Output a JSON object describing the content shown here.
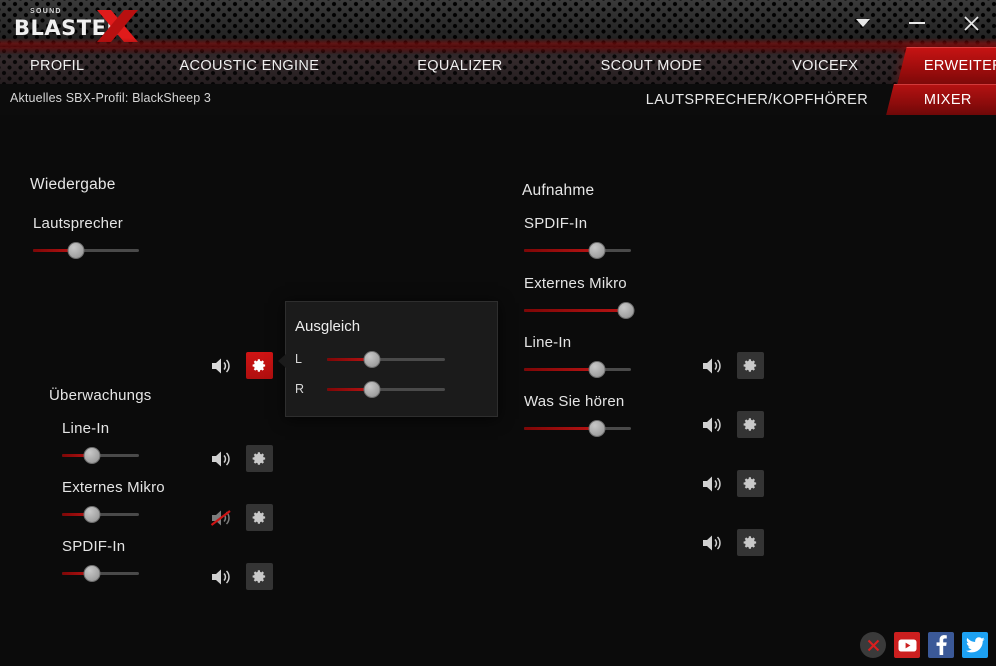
{
  "titlebar": {
    "logo_top": "SOUND",
    "logo_main": "BLASTER",
    "logo_x": "X",
    "dropdown_icon": "chevron-down-icon",
    "minimize_icon": "minimize-icon",
    "close_icon": "close-icon"
  },
  "tabs": [
    {
      "label": "PROFIL",
      "active": false
    },
    {
      "label": "ACOUSTIC ENGINE",
      "active": false
    },
    {
      "label": "EQUALIZER",
      "active": false
    },
    {
      "label": "SCOUT MODE",
      "active": false
    },
    {
      "label": "VOICEFX",
      "active": false
    },
    {
      "label": "ERWEITERTE EINSTELLUNGEN",
      "active": true
    }
  ],
  "subheader": {
    "profile_text": "Aktuelles SBX-Profil: BlackSheep 3",
    "subtabs": [
      {
        "label": "LAUTSPRECHER/KOPFHÖRER",
        "active": false
      },
      {
        "label": "MIXER",
        "active": true
      }
    ]
  },
  "playback": {
    "title": "Wiedergabe",
    "channels": [
      {
        "label": "Lautsprecher",
        "value": 41,
        "muted": false,
        "gear_active": true,
        "indent": false
      },
      {
        "label": "Überwachungs",
        "value": null,
        "is_group_label": true
      },
      {
        "label": "Line-In",
        "value": 39,
        "muted": false,
        "gear_active": false,
        "indent": true
      },
      {
        "label": "Externes Mikro",
        "value": 39,
        "muted": true,
        "gear_active": false,
        "indent": true
      },
      {
        "label": "SPDIF-In",
        "value": 39,
        "muted": false,
        "gear_active": false,
        "indent": true
      }
    ]
  },
  "recording": {
    "title": "Aufnahme",
    "channels": [
      {
        "label": "SPDIF-In",
        "value": 68,
        "muted": false,
        "gear_active": false
      },
      {
        "label": "Externes Mikro",
        "value": 95,
        "muted": false,
        "gear_active": false
      },
      {
        "label": "Line-In",
        "value": 68,
        "muted": false,
        "gear_active": false
      },
      {
        "label": "Was Sie hören",
        "value": 68,
        "muted": false,
        "gear_active": false
      }
    ]
  },
  "balance_popup": {
    "title": "Ausgleich",
    "left": {
      "label": "L",
      "value": 38
    },
    "right": {
      "label": "R",
      "value": 38
    }
  },
  "social": [
    {
      "name": "close-overlay-icon",
      "color": "#3a3a3a"
    },
    {
      "name": "youtube-icon",
      "color": "#cc1f1f"
    },
    {
      "name": "facebook-icon",
      "color": "#3b5998"
    },
    {
      "name": "twitter-icon",
      "color": "#1da1f2"
    }
  ],
  "colors": {
    "accent_red": "#b81414",
    "panel_bg": "#0b0b0b",
    "knob": "#a9a9a9"
  }
}
